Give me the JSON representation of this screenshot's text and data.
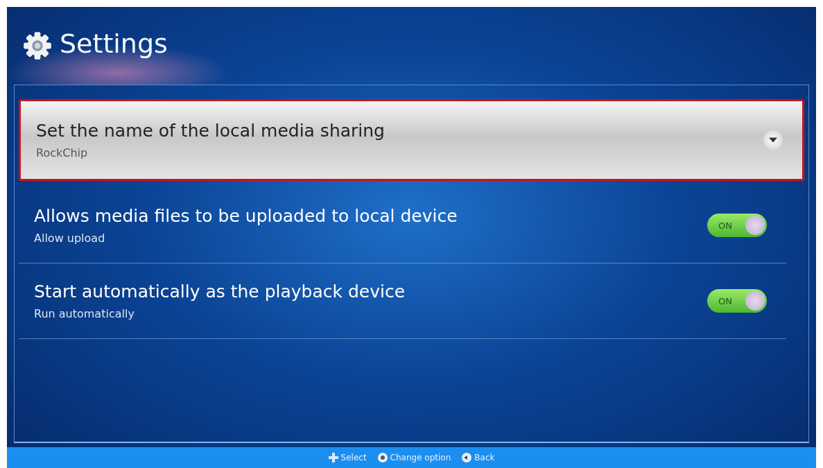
{
  "header": {
    "title": "Settings"
  },
  "settings": [
    {
      "kind": "dropdown",
      "title": "Set the name of the local media sharing",
      "value": "RockChip",
      "selected": true
    },
    {
      "kind": "toggle",
      "title": "Allows media files to be uploaded to local device",
      "value": "Allow upload",
      "selected": false,
      "on": true,
      "switch_label": "ON"
    },
    {
      "kind": "toggle",
      "title": "Start automatically as the playback device",
      "value": "Run automatically",
      "selected": false,
      "on": true,
      "switch_label": "ON"
    }
  ],
  "hints": [
    {
      "kind": "dpad",
      "label": "Select"
    },
    {
      "kind": "ok",
      "label": "Change option"
    },
    {
      "kind": "back",
      "label": "Back"
    }
  ]
}
